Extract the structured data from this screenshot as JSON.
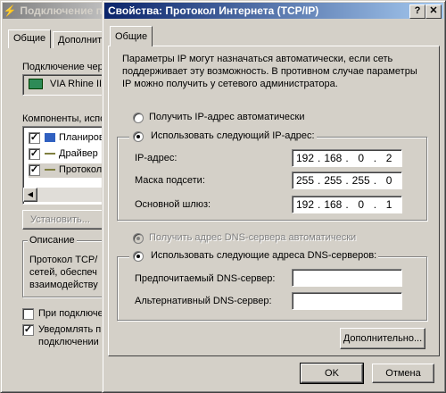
{
  "back_window": {
    "title": "Подключение п",
    "tabs": [
      "Общие",
      "Дополнит"
    ],
    "connect_label": "Подключение чер",
    "adapter_name": "VIA Rhine II",
    "components_label": "Компоненты, испо",
    "components": [
      {
        "label": "Планиров",
        "checked": true
      },
      {
        "label": "Драйвер",
        "checked": true
      },
      {
        "label": "Протокол",
        "checked": true
      }
    ],
    "install_button": "Установить...",
    "description_legend": "Описание",
    "description_lines": [
      "Протокол TCP/",
      "сетей, обеспеч",
      "взаимодейству"
    ],
    "option1": "При подключе",
    "option2_line1": "Уведомлять п",
    "option2_line2": "подключении"
  },
  "dialog": {
    "title": "Свойства: Протокол Интернета (TCP/IP)",
    "help_button": "?",
    "close_button": "✕",
    "tab": "Общие",
    "info_text": "Параметры IP могут назначаться автоматически, если сеть поддерживает эту возможность. В противном случае параметры IP можно получить у сетевого администратора.",
    "ip_auto": "Получить IP-адрес автоматически",
    "ip_manual": "Использовать следующий IP-адрес:",
    "ip_label": "IP-адрес:",
    "ip_value": [
      "192",
      "168",
      "0",
      "2"
    ],
    "mask_label": "Маска подсети:",
    "mask_value": [
      "255",
      "255",
      "255",
      "0"
    ],
    "gateway_label": "Основной шлюз:",
    "gateway_value": [
      "192",
      "168",
      "0",
      "1"
    ],
    "dns_auto": "Получить адрес DNS-сервера автоматически",
    "dns_manual": "Использовать следующие адреса DNS-серверов:",
    "dns_preferred_label": "Предпочитаемый DNS-сервер:",
    "dns_alternate_label": "Альтернативный DNS-сервер:",
    "advanced_button": "Дополнительно...",
    "ok_button": "OK",
    "cancel_button": "Отмена"
  }
}
